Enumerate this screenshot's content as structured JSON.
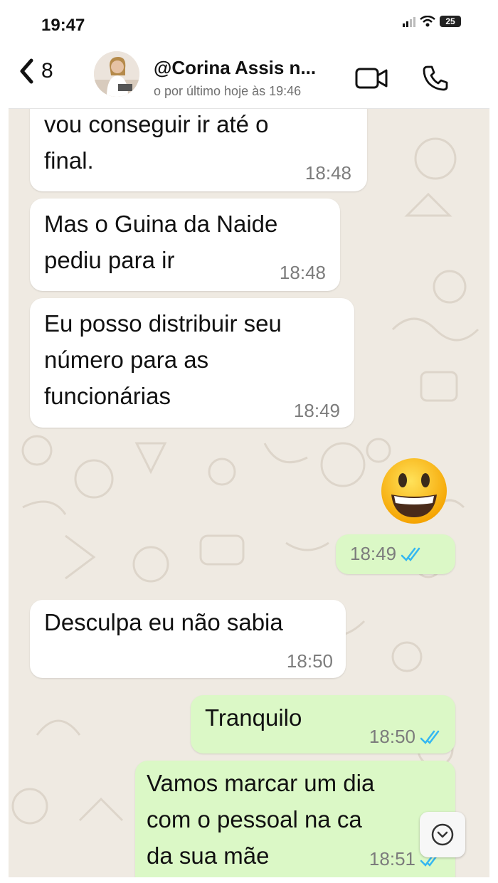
{
  "status_bar": {
    "time": "19:47",
    "battery": "25",
    "signal_icon": "signal-icon",
    "wifi_icon": "wifi-icon"
  },
  "header": {
    "back_count": "8",
    "contact_name": "@Corina Assis n...",
    "last_seen": "o por último hoje às 19:46",
    "video_icon": "video-camera-icon",
    "call_icon": "phone-icon"
  },
  "colors": {
    "chat_background": "#efeae2",
    "incoming_bubble": "#ffffff",
    "outgoing_bubble": "#dbf8c6",
    "read_ticks": "#34b7f1"
  },
  "messages": [
    {
      "direction": "in",
      "text": "vou conseguir ir até o\nfinal.",
      "time": "18:48"
    },
    {
      "direction": "in",
      "text": "Mas o Guina da Naide\npediu para ir",
      "time": "18:48"
    },
    {
      "direction": "in",
      "text": "Eu posso distribuir seu\nnúmero para as\nfuncionárias",
      "time": "18:49"
    },
    {
      "direction": "out",
      "text": "😀",
      "time": "18:49",
      "status": "read"
    },
    {
      "direction": "in",
      "text": "Desculpa eu não sabia",
      "time": "18:50"
    },
    {
      "direction": "out",
      "text": "Tranquilo",
      "time": "18:50",
      "status": "read"
    },
    {
      "direction": "out",
      "text": "Vamos marcar um dia\ncom o pessoal na ca\nda sua mãe",
      "time": "18:51",
      "status": "read"
    }
  ],
  "scroll_button_icon": "chevron-down-icon"
}
